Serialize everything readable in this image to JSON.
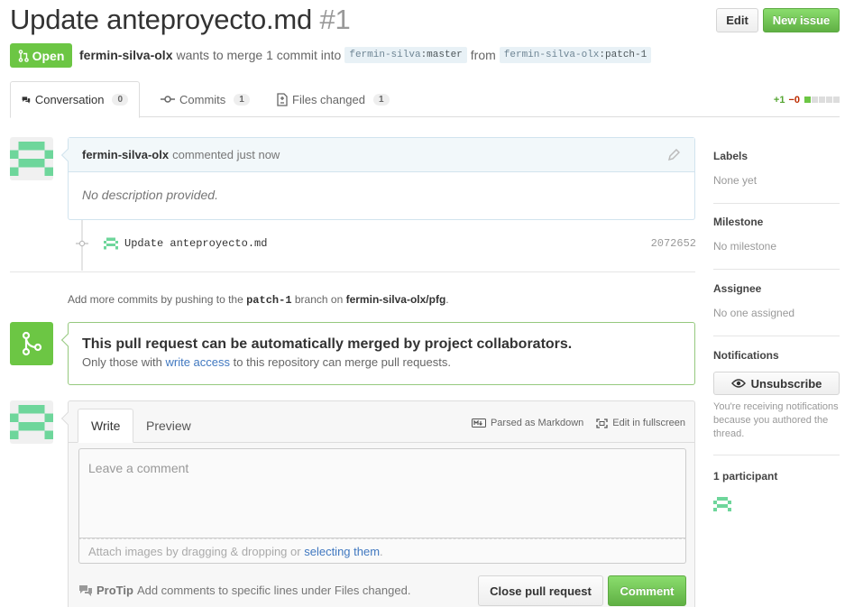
{
  "header": {
    "title": "Update anteproyecto.md",
    "number": "#1",
    "edit_label": "Edit",
    "new_issue_label": "New issue"
  },
  "status": {
    "state": "Open",
    "author": "fermin-silva-olx",
    "text": "wants to merge 1 commit into",
    "base_user": "fermin-silva",
    "base_branch": "master",
    "from_text": "from",
    "head_user": "fermin-silva-olx",
    "head_branch": "patch-1"
  },
  "tabs": [
    {
      "label": "Conversation",
      "count": "0"
    },
    {
      "label": "Commits",
      "count": "1"
    },
    {
      "label": "Files changed",
      "count": "1"
    }
  ],
  "diffstat": {
    "additions": "+1",
    "deletions": "−0"
  },
  "comment": {
    "author": "fermin-silva-olx",
    "action": "commented just now",
    "body": "No description provided."
  },
  "commit": {
    "message": "Update anteproyecto.md",
    "sha": "2072652"
  },
  "push_hint": {
    "prefix": "Add more commits by pushing to the",
    "branch": "patch-1",
    "middle": "branch on",
    "repo": "fermin-silva-olx/pfg",
    "suffix": "."
  },
  "merge": {
    "title": "This pull request can be automatically merged by project collaborators.",
    "prefix": "Only those with",
    "link": "write access",
    "suffix": "to this repository can merge pull requests."
  },
  "editor": {
    "write_tab": "Write",
    "preview_tab": "Preview",
    "markdown_label": "Parsed as Markdown",
    "fullscreen_label": "Edit in fullscreen",
    "placeholder": "Leave a comment",
    "attach_prefix": "Attach images by dragging & dropping or",
    "attach_link": "selecting them",
    "attach_suffix": ".",
    "protip_label": "ProTip",
    "protip_text": "Add comments to specific lines under Files changed.",
    "close_label": "Close pull request",
    "comment_label": "Comment"
  },
  "sidebar": {
    "labels_title": "Labels",
    "labels_value": "None yet",
    "milestone_title": "Milestone",
    "milestone_value": "No milestone",
    "assignee_title": "Assignee",
    "assignee_value": "No one assigned",
    "notifications_title": "Notifications",
    "unsubscribe_label": "Unsubscribe",
    "notifications_reason": "You're receiving notifications because you authored the thread.",
    "participants_title": "1 participant"
  },
  "colors": {
    "green": "#6cc644",
    "link": "#4078c0",
    "identicon": "#6ed69b"
  }
}
